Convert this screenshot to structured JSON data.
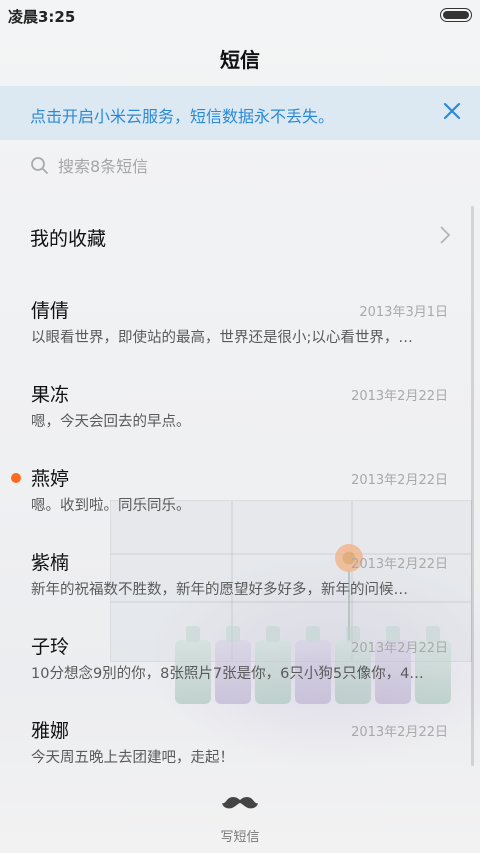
{
  "status_bar": {
    "time": "凌晨3:25"
  },
  "app": {
    "title": "短信"
  },
  "banner": {
    "text": "点击开启小米云服务，短信数据永不丢失。"
  },
  "search": {
    "placeholder": "搜索8条短信"
  },
  "favorites": {
    "label": "我的收藏"
  },
  "conversations": [
    {
      "name": "倩倩",
      "date": "2013年3月1日",
      "snippet": "以眼看世界，即使站的最高，世界还是很小;以心看世界，…",
      "unread": false
    },
    {
      "name": "果冻",
      "date": "2013年2月22日",
      "snippet": "嗯，今天会回去的早点。",
      "unread": false
    },
    {
      "name": "燕婷",
      "date": "2013年2月22日",
      "snippet": "嗯。收到啦。同乐同乐。",
      "unread": true
    },
    {
      "name": "紫楠",
      "date": "2013年2月22日",
      "snippet": "新年的祝福数不胜数，新年的愿望好多好多，新年的问候…",
      "unread": false
    },
    {
      "name": "子玲",
      "date": "2013年2月22日",
      "snippet": "10分想念9別的你，8张照片7张是你，6只小狗5只像你，4…",
      "unread": false
    },
    {
      "name": "雅娜",
      "date": "2013年2月22日",
      "snippet": "今天周五晚上去团建吧，走起！",
      "unread": false
    }
  ],
  "compose": {
    "label": "写短信"
  },
  "colors": {
    "accent": "#2a8ad8",
    "unread_dot": "#ff6a1f",
    "banner_bg": "#dde9f2"
  },
  "icons": {
    "search": "search-icon",
    "close": "close-icon",
    "chevron": "chevron-right-icon",
    "compose": "mustache-icon"
  }
}
